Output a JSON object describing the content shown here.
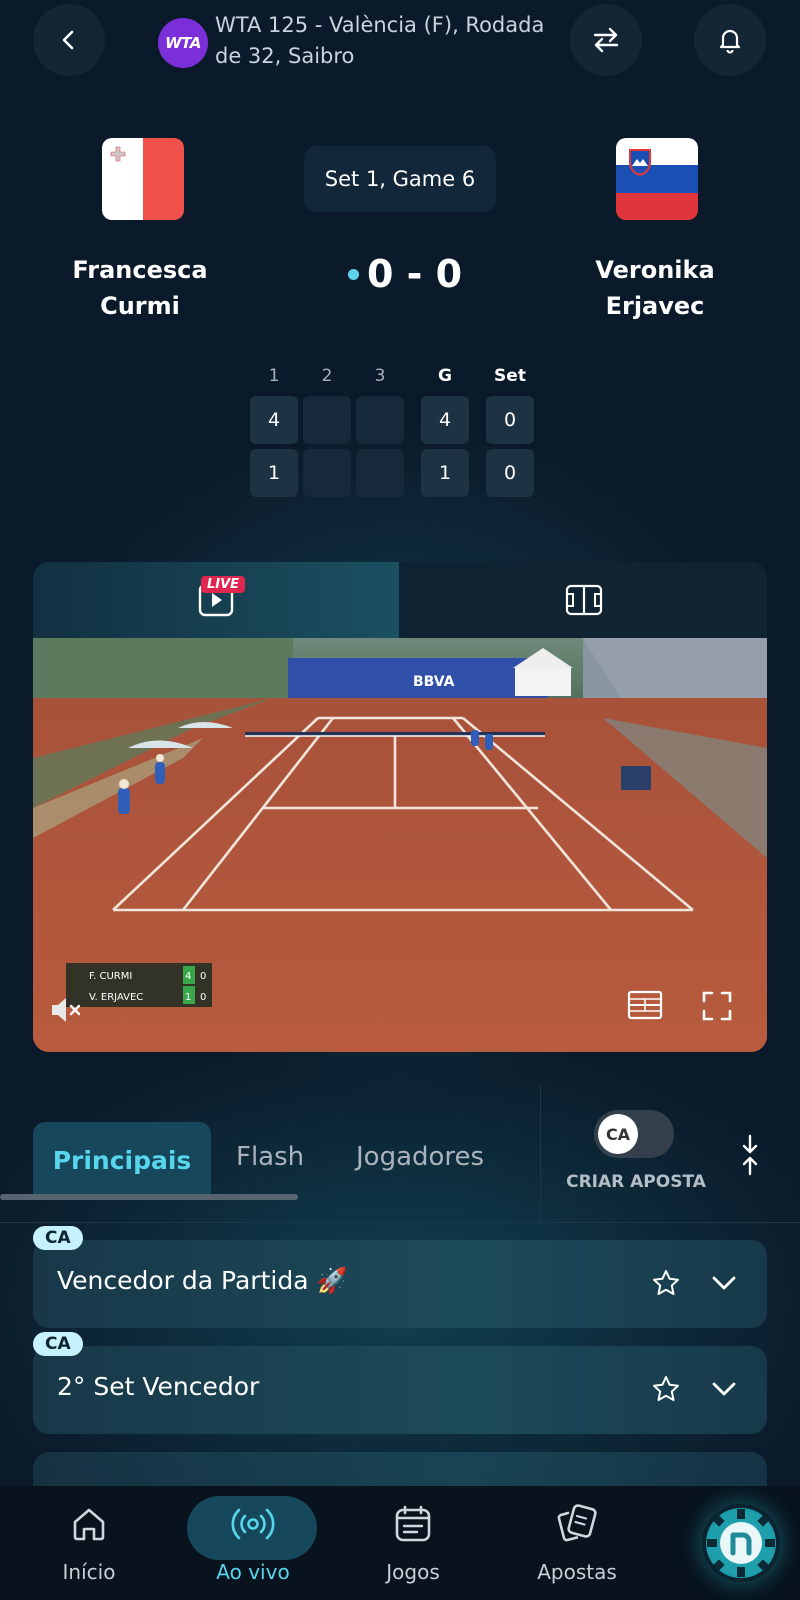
{
  "header": {
    "logo_text": "WTA",
    "tournament_title": "WTA 125 - València (F), Rodada de 32, Saibro"
  },
  "match": {
    "set_game": "Set 1, Game 6",
    "score": "0 - 0",
    "player1": {
      "first": "Francesca",
      "last": "Curmi",
      "country": "Malta"
    },
    "player2": {
      "first": "Veronika",
      "last": "Erjavec",
      "country": "Slovenia"
    }
  },
  "scoreboard": {
    "headers": [
      "1",
      "2",
      "3",
      "G",
      "Set"
    ],
    "rows": [
      [
        "4",
        "",
        "",
        "4",
        "0"
      ],
      [
        "1",
        "",
        "",
        "1",
        "0"
      ]
    ]
  },
  "video": {
    "live_label": "LIVE",
    "overlay": {
      "p1": "F. CURMI",
      "p1_games": "4",
      "p1_points": "0",
      "p2": "V. ERJAVEC",
      "p2_games": "1",
      "p2_points": "0"
    },
    "sponsor": "BBVA"
  },
  "tabs": {
    "items": [
      "Principais",
      "Flash",
      "Jogadores"
    ],
    "active": "Principais",
    "toggle_label": "CA",
    "criar_aposta": "CRIAR APOSTA"
  },
  "markets": [
    {
      "badge": "CA",
      "title": "Vencedor da Partida 🚀"
    },
    {
      "badge": "CA",
      "title": "2° Set Vencedor"
    }
  ],
  "nav": {
    "items": [
      "Início",
      "Ao vivo",
      "Jogos",
      "Apostas"
    ],
    "active": "Ao vivo"
  },
  "colors": {
    "background": "#0b1a2a",
    "accent": "#57d6ee",
    "live": "#e0264f",
    "wta": "#7b2fd8"
  }
}
